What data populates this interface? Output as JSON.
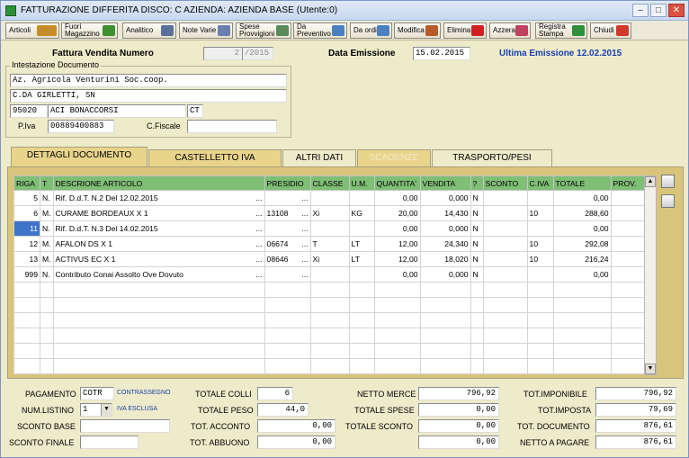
{
  "window": {
    "title": "FATTURAZIONE DIFFERITA   DISCO: C   AZIENDA: AZIENDA BASE (Utente:0)",
    "minimize": "–",
    "restore": "□",
    "close": "✕"
  },
  "toolbar": [
    {
      "label": "Articoli",
      "icon": "people-icon",
      "color": "#c78c2a"
    },
    {
      "label": "Fuori Magazzino",
      "icon": "check-icon",
      "color": "#3d8f2f"
    },
    {
      "label": "Analitico",
      "icon": "list-icon",
      "color": "#5a6f9a"
    },
    {
      "label": "Note Varie",
      "icon": "notes-icon",
      "color": "#6b7fae"
    },
    {
      "label": "Spese Provvigioni",
      "icon": "table-icon",
      "color": "#5a8a5a"
    },
    {
      "label": "Da Preventivo",
      "icon": "doc-icon",
      "color": "#4a7fc0"
    },
    {
      "label": "Da ordine",
      "icon": "doc-icon",
      "color": "#4a7fc0"
    },
    {
      "label": "Modifica",
      "icon": "pencil-icon",
      "color": "#b85a2a"
    },
    {
      "label": "Elimina",
      "icon": "delete-icon",
      "color": "#d02020"
    },
    {
      "label": "Azzera",
      "icon": "erase-icon",
      "color": "#c04060"
    },
    {
      "label": "Registra Stampa",
      "icon": "save-icon",
      "color": "#2f8f3a"
    },
    {
      "label": "Chiudi",
      "icon": "exit-icon",
      "color": "#d03a2a"
    }
  ],
  "header": {
    "invoice_number_label": "Fattura Vendita Numero",
    "invoice_number": "2",
    "invoice_year": "/2015",
    "issue_date_label": "Data Emissione",
    "issue_date": "15.02.2015",
    "last_issue": "Ultima Emissione 12.02.2015"
  },
  "intestazione": {
    "legend": "Intestazione Documento",
    "name": "Az. Agricola Venturini Soc.coop.",
    "address": "C.DA GIRLETTI, SN",
    "cap": "95020",
    "city": "ACI BONACCORSI",
    "province": "CT",
    "piva_label": "P.Iva",
    "piva": "00889400883",
    "cf_label": "C.Fiscale",
    "cf": ""
  },
  "tabs": [
    "DETTAGLI DOCUMENTO",
    "CASTELLETTO IVA",
    "ALTRI DATI",
    "SCADENZE",
    "TRASPORTO/PESI"
  ],
  "grid": {
    "columns": [
      "RIGA",
      "T",
      "DESCRIONE ARTICOLO",
      "PRESIDIO",
      "CLASSE",
      "U.M.",
      "QUANTITA'",
      "VENDITA",
      "?",
      "SCONTO",
      "C.IVA",
      "TOTALE",
      "PROV."
    ],
    "rows": [
      {
        "riga": "5",
        "t": "N.",
        "desc": "Rif. D.d.T. N.2 Del 12.02.2015",
        "presidio": "",
        "classe": "",
        "um": "",
        "qta": "0,00",
        "vendita": "0,000",
        "q": "N",
        "sconto": "",
        "civa": "",
        "totale": "0,00",
        "prov": ""
      },
      {
        "riga": "6",
        "t": "M.",
        "desc": "CURAME BORDEAUX X 1",
        "presidio": "13108",
        "classe": "Xi",
        "um": "KG",
        "qta": "20,00",
        "vendita": "14,430",
        "q": "N",
        "sconto": "",
        "civa": "10",
        "totale": "288,60",
        "prov": ""
      },
      {
        "riga": "11",
        "t": "N.",
        "desc": "Rif. D.d.T. N.3 Del 14.02.2015",
        "presidio": "",
        "classe": "",
        "um": "",
        "qta": "0,00",
        "vendita": "0,000",
        "q": "N",
        "sconto": "",
        "civa": "",
        "totale": "0,00",
        "prov": ""
      },
      {
        "riga": "12",
        "t": "M.",
        "desc": "AFALON DS X 1",
        "presidio": "06674",
        "classe": "T",
        "um": "LT",
        "qta": "12,00",
        "vendita": "24,340",
        "q": "N",
        "sconto": "",
        "civa": "10",
        "totale": "292,08",
        "prov": ""
      },
      {
        "riga": "13",
        "t": "M.",
        "desc": "ACTIVUS EC X 1",
        "presidio": "08646",
        "classe": "Xi",
        "um": "LT",
        "qta": "12,00",
        "vendita": "18,020",
        "q": "N",
        "sconto": "",
        "civa": "10",
        "totale": "216,24",
        "prov": ""
      },
      {
        "riga": "999",
        "t": "N.",
        "desc": "Contributo Conai Assolto Ove Dovuto",
        "presidio": "",
        "classe": "",
        "um": "",
        "qta": "0,00",
        "vendita": "0,000",
        "q": "N",
        "sconto": "",
        "civa": "",
        "totale": "0,00",
        "prov": ""
      }
    ],
    "ellipsis": "...",
    "selected_riga": "11"
  },
  "footer": {
    "pagamento_label": "PAGAMENTO",
    "pagamento": "COTR",
    "pagamento_desc": "CONTRASSEGNO",
    "listino_label": "NUM.LISTINO",
    "listino": "1",
    "listino_desc": "IVA ESCLUSA",
    "sconto_base_label": "SCONTO BASE",
    "sconto_base": "",
    "sconto_finale_label": "SCONTO FINALE",
    "sconto_finale": "",
    "totale_colli_label": "TOTALE COLLI",
    "totale_colli": "6",
    "totale_peso_label": "TOTALE PESO",
    "totale_peso": "44,0",
    "tot_acconto_label": "TOT. ACCONTO",
    "tot_acconto": "0,00",
    "tot_abbuono_label": "TOT. ABBUONO",
    "tot_abbuono": "0,00",
    "netto_merce_label": "NETTO MERCE",
    "netto_merce": "796,92",
    "totale_spese_label": "TOTALE SPESE",
    "totale_spese": "0,00",
    "totale_sconto_label": "TOTALE SCONTO",
    "totale_sconto": "0,00",
    "extra_label": "",
    "extra": "0,00",
    "tot_imponibile_label": "TOT.IMPONIBILE",
    "tot_imponibile": "796,92",
    "tot_imposta_label": "TOT.IMPOSTA",
    "tot_imposta": "79,69",
    "tot_documento_label": "TOT. DOCUMENTO",
    "tot_documento": "876,61",
    "netto_pagare_label": "NETTO A PAGARE",
    "netto_pagare": "876,61"
  }
}
